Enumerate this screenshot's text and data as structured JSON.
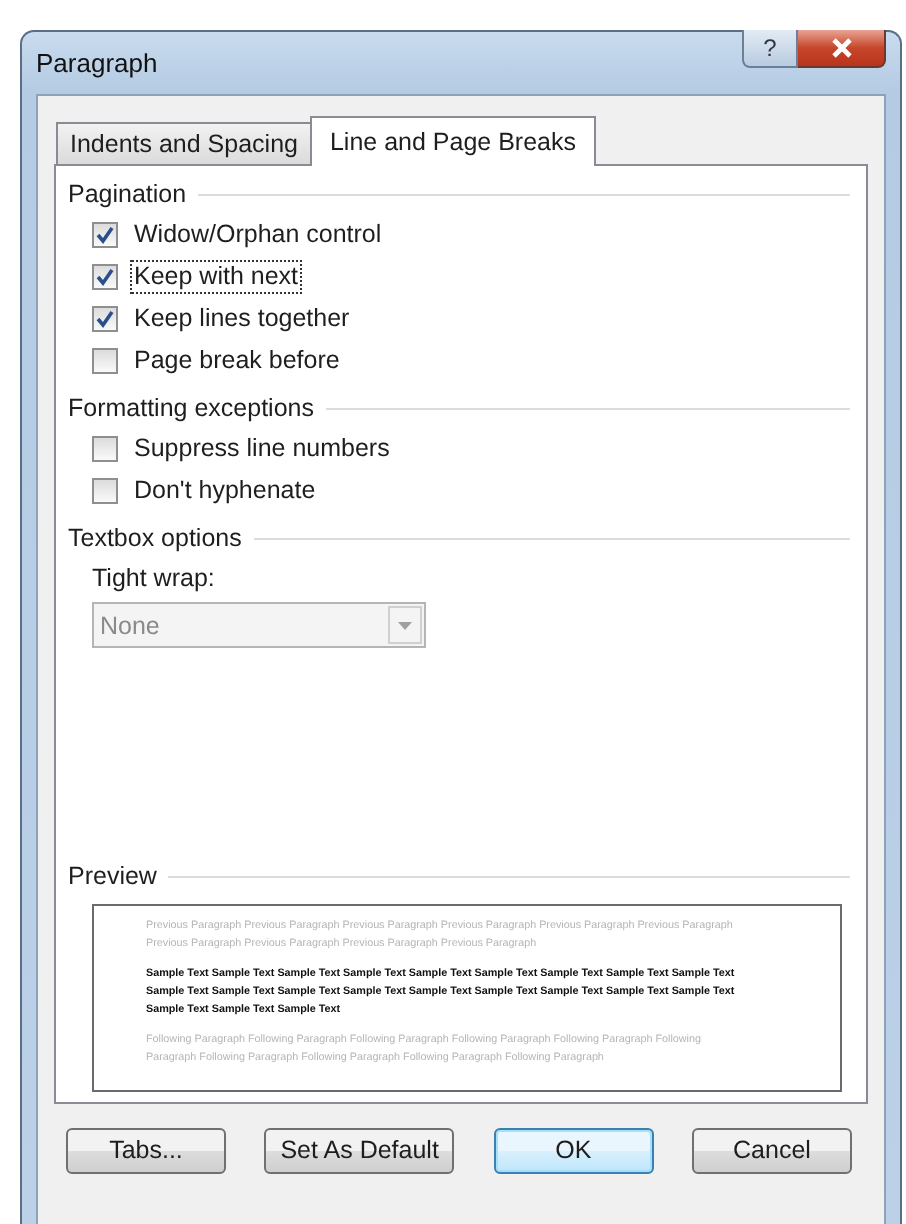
{
  "window": {
    "title": "Paragraph",
    "help_label": "?"
  },
  "tabs": [
    {
      "label": "Indents and Spacing",
      "selected": false
    },
    {
      "label": "Line and Page Breaks",
      "selected": true
    }
  ],
  "sections": [
    {
      "kind": "checks",
      "title": "Pagination",
      "items": [
        {
          "label": "Widow/Orphan control",
          "checked": true,
          "focused": false
        },
        {
          "label": "Keep with next",
          "checked": true,
          "focused": true
        },
        {
          "label": "Keep lines together",
          "checked": true,
          "focused": false
        },
        {
          "label": "Page break before",
          "checked": false,
          "focused": false
        }
      ]
    },
    {
      "kind": "checks",
      "title": "Formatting exceptions",
      "items": [
        {
          "label": "Suppress line numbers",
          "checked": false,
          "focused": false
        },
        {
          "label": "Don't hyphenate",
          "checked": false,
          "focused": false
        }
      ]
    },
    {
      "kind": "combo",
      "title": "Textbox options",
      "label": "Tight wrap:",
      "value": "None",
      "disabled": true
    }
  ],
  "preview": {
    "title": "Preview",
    "previous": "Previous Paragraph Previous Paragraph Previous Paragraph Previous Paragraph Previous Paragraph Previous Paragraph Previous Paragraph Previous Paragraph Previous Paragraph Previous Paragraph",
    "sample": "Sample Text Sample Text Sample Text Sample Text Sample Text Sample Text Sample Text Sample Text Sample Text Sample Text Sample Text Sample Text Sample Text Sample Text Sample Text Sample Text Sample Text Sample Text Sample Text Sample Text Sample Text",
    "following": "Following Paragraph Following Paragraph Following Paragraph Following Paragraph Following Paragraph Following Paragraph Following Paragraph Following Paragraph Following Paragraph Following Paragraph"
  },
  "buttons": [
    {
      "label": "Tabs...",
      "default": false
    },
    {
      "label": "Set As Default",
      "default": false
    },
    {
      "label": "OK",
      "default": true
    },
    {
      "label": "Cancel",
      "default": false
    }
  ]
}
